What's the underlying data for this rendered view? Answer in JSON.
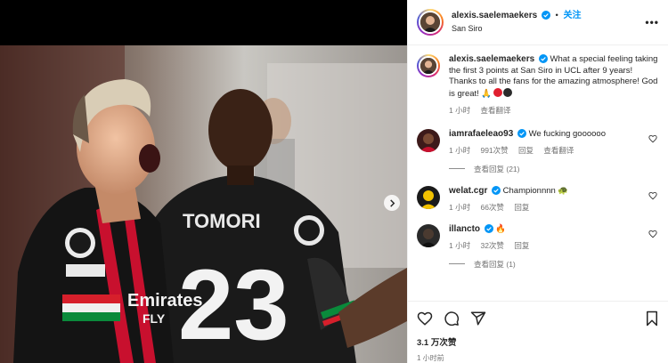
{
  "post": {
    "username": "alexis.saelemaekers",
    "follow_label": "关注",
    "separator": "•",
    "location": "San Siro",
    "more_label": "•••",
    "caption": "What a special feeling taking the first 3 points at San Siro in UCL after 9 years! Thanks to all the fans for the amazing atmosphere! God is great! 🙏",
    "caption_time": "1 小时",
    "see_translation": "查看翻译",
    "likes": "3.1 万次赞",
    "posted_time": "1 小时前"
  },
  "photo": {
    "shirt_name": "TOMORI",
    "shirt_number": "23",
    "sponsor": "Emirates",
    "sponsor_line2": "FLY"
  },
  "comments": [
    {
      "username": "iamrafaeleao93",
      "verified": true,
      "text": "We fucking goooooo",
      "time": "1 小时",
      "likes": "991次赞",
      "reply": "回复",
      "translate": "查看翻译",
      "view_replies": "查看回复 (21)"
    },
    {
      "username": "welat.cgr",
      "verified": true,
      "text": "Championnnn 🐢",
      "time": "1 小时",
      "likes": "66次赞",
      "reply": "回复",
      "translate": "",
      "view_replies": ""
    },
    {
      "username": "illancto",
      "verified": true,
      "text": "🔥",
      "time": "1 小时",
      "likes": "32次赞",
      "reply": "回复",
      "translate": "",
      "view_replies": "查看回复 (1)"
    }
  ],
  "colors": {
    "accent": "#0095f6",
    "verified": "#0095f6",
    "ac_milan_red": "#c8102e",
    "ac_milan_black": "#111111"
  },
  "icons": [
    "heart-icon",
    "comment-icon",
    "share-icon",
    "bookmark-icon",
    "chevron-right-icon",
    "verified-icon"
  ]
}
